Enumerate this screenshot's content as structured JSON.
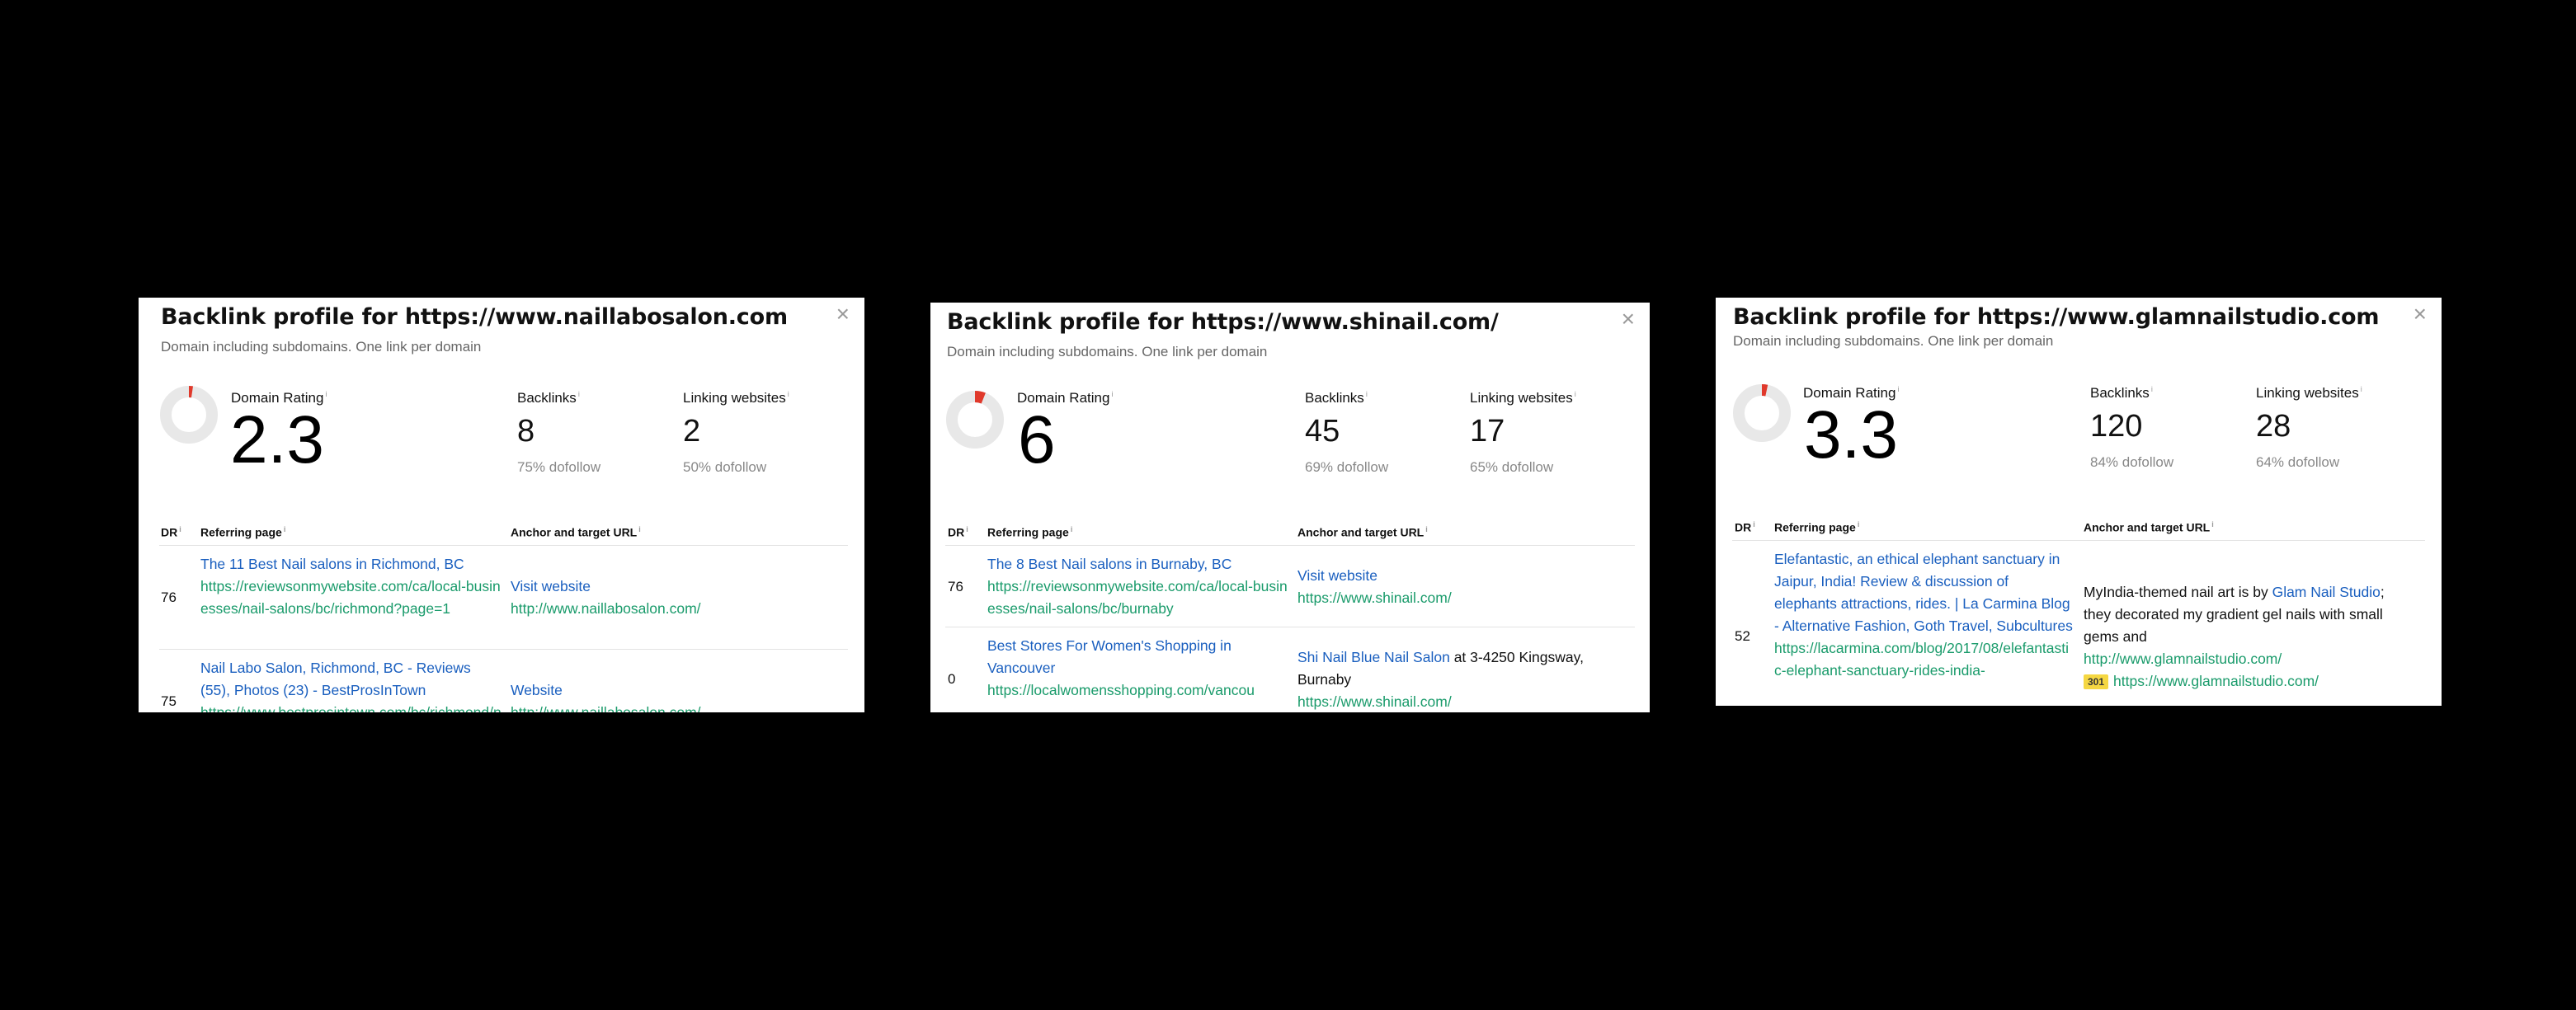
{
  "panels": [
    {
      "title": "Backlink profile for https://www.naillabosalon.com",
      "subtitle": "Domain including subdomains. One link per domain",
      "close": "×",
      "domain_rating": {
        "label": "Domain Rating",
        "value": "2.3",
        "fill": 0.023
      },
      "backlinks": {
        "label": "Backlinks",
        "value": "8",
        "sub": "75% dofollow"
      },
      "linking": {
        "label": "Linking websites",
        "value": "2",
        "sub": "50% dofollow"
      },
      "columns": {
        "dr": "DR",
        "referring": "Referring page",
        "anchor": "Anchor and target URL"
      },
      "rows": [
        {
          "dr": "76",
          "title": "The 11 Best Nail salons in Richmond, BC",
          "url": "https://reviewsonmywebsite.com/ca/local-businesses/nail-salons/bc/richmond?page=1",
          "anchor": "Visit website",
          "target": "http://www.naillabosalon.com/"
        },
        {
          "dr": "75",
          "title": "Nail Labo Salon, Richmond, BC - Reviews (55), Photos (23) - BestProsInTown",
          "url": "https://www.bestprosintown.com/bc/richmond/nail-labo-salon",
          "anchor": "Website",
          "target": "http://www.naillabosalon.com/"
        }
      ]
    },
    {
      "title": "Backlink profile for https://www.shinail.com/",
      "subtitle": "Domain including subdomains. One link per domain",
      "close": "×",
      "domain_rating": {
        "label": "Domain Rating",
        "value": "6",
        "fill": 0.06
      },
      "backlinks": {
        "label": "Backlinks",
        "value": "45",
        "sub": "69% dofollow"
      },
      "linking": {
        "label": "Linking websites",
        "value": "17",
        "sub": "65% dofollow"
      },
      "columns": {
        "dr": "DR",
        "referring": "Referring page",
        "anchor": "Anchor and target URL"
      },
      "rows": [
        {
          "dr": "76",
          "title": "The 8 Best Nail salons in Burnaby, BC",
          "url": "https://reviewsonmywebsite.com/ca/local-businesses/nail-salons/bc/burnaby",
          "anchor": "Visit website",
          "target": "https://www.shinail.com/"
        },
        {
          "dr": "0",
          "title": "Best Stores For Women's Shopping in Vancouver",
          "url": "https://localwomensshopping.com/vancou",
          "anchor": "Shi Nail Blue Nail Salon",
          "anchor_after": " at 3-4250 Kingsway, Burnaby",
          "target": "https://www.shinail.com/"
        }
      ]
    },
    {
      "title": "Backlink profile for https://www.glamnailstudio.com",
      "subtitle": "Domain including subdomains. One link per domain",
      "close": "×",
      "domain_rating": {
        "label": "Domain Rating",
        "value": "3.3",
        "fill": 0.033
      },
      "backlinks": {
        "label": "Backlinks",
        "value": "120",
        "sub": "84% dofollow"
      },
      "linking": {
        "label": "Linking websites",
        "value": "28",
        "sub": "64% dofollow"
      },
      "columns": {
        "dr": "DR",
        "referring": "Referring page",
        "anchor": "Anchor and target URL"
      },
      "rows": [
        {
          "dr": "52",
          "title": "Elefantastic, an ethical elephant sanctuary in Jaipur, India! Review & discussion of elephants attractions, rides. | La Carmina Blog - Alternative Fashion, Goth Travel, Subcultures",
          "url": "https://lacarmina.com/blog/2017/08/elefantastic-elephant-sanctuary-rides-india-",
          "anchor_before": "MyIndia-themed nail art is by ",
          "anchor": "Glam Nail Studio",
          "anchor_after": "; they decorated my gradient gel nails with small gems and",
          "target": "http://www.glamnailstudio.com/",
          "redirect_badge": "301",
          "redirect_target": "https://www.glamnailstudio.com/"
        }
      ]
    }
  ],
  "colors": {
    "dr_fill": "#e0392b",
    "donut_track": "#e8e8e8",
    "link": "#1a5fbf",
    "url": "#1a9b6b"
  }
}
